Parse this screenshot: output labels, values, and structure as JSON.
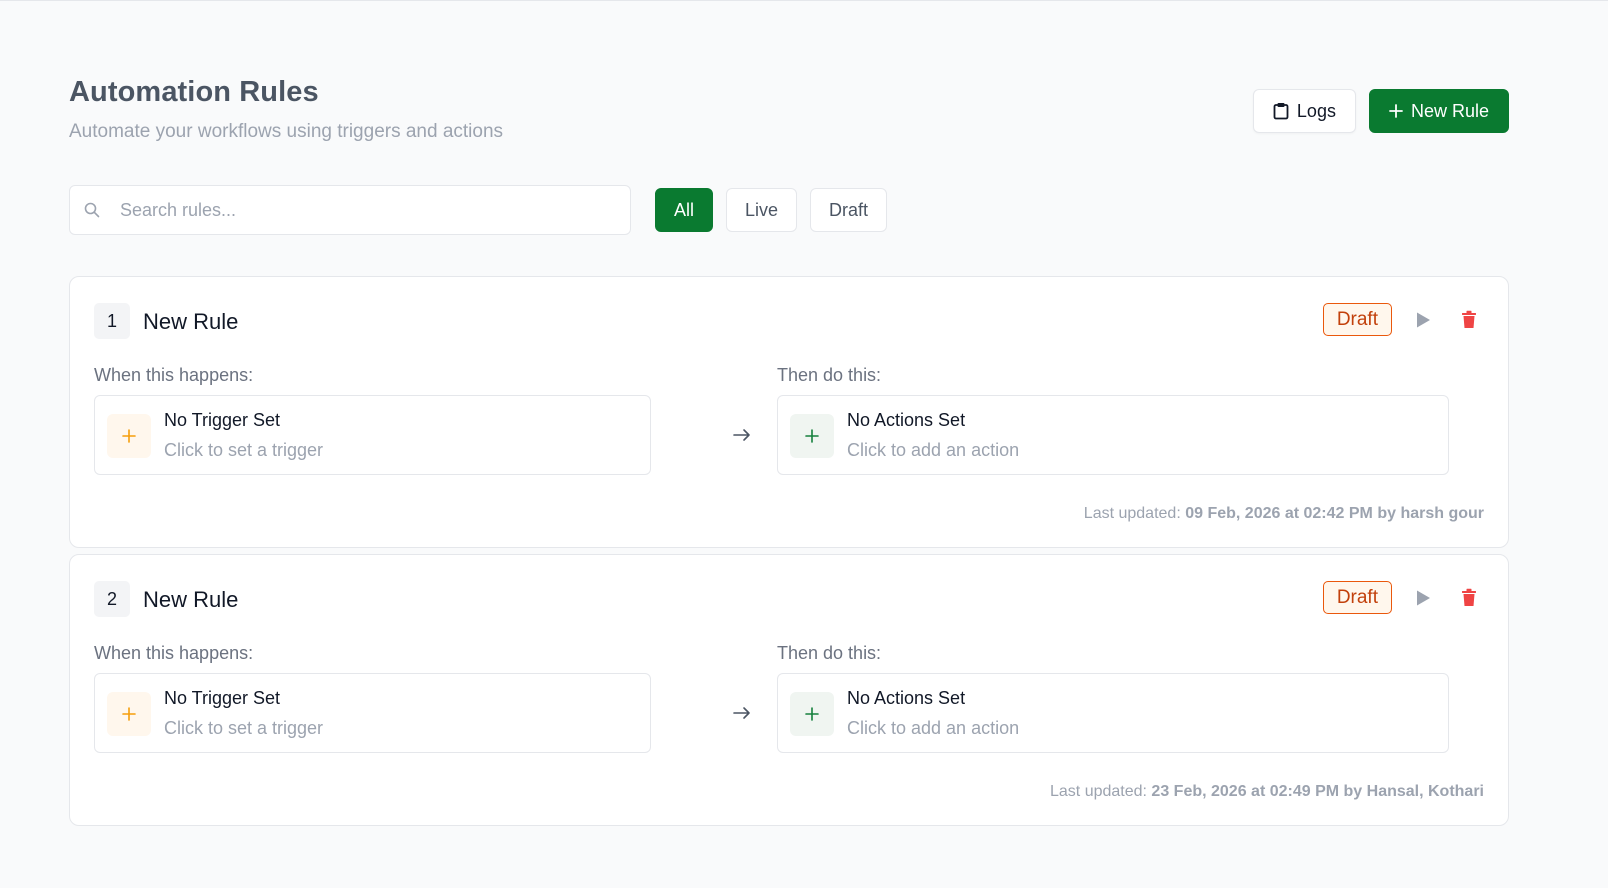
{
  "header": {
    "title": "Automation Rules",
    "subtitle": "Automate your workflows using triggers and actions",
    "logs_label": "Logs",
    "new_rule_label": "New Rule"
  },
  "search": {
    "placeholder": "Search rules...",
    "value": ""
  },
  "filters": [
    {
      "label": "All",
      "active": true
    },
    {
      "label": "Live",
      "active": false
    },
    {
      "label": "Draft",
      "active": false
    }
  ],
  "rules": [
    {
      "number": "1",
      "name": "New Rule",
      "status": "Draft",
      "when_label": "When this happens:",
      "then_label": "Then do this:",
      "trigger_title": "No Trigger Set",
      "trigger_sub": "Click to set a trigger",
      "action_title": "No Actions Set",
      "action_sub": "Click to add an action",
      "updated_label": "Last updated:",
      "updated_value": "09 Feb, 2026 at 02:42 PM by harsh gour"
    },
    {
      "number": "2",
      "name": "New Rule",
      "status": "Draft",
      "when_label": "When this happens:",
      "then_label": "Then do this:",
      "trigger_title": "No Trigger Set",
      "trigger_sub": "Click to set a trigger",
      "action_title": "No Actions Set",
      "action_sub": "Click to add an action",
      "updated_label": "Last updated:",
      "updated_value": "23 Feb, 2026 at 02:49 PM by Hansal, Kothari"
    }
  ],
  "colors": {
    "primary": "#0a7a30",
    "draft_border": "#ea580c",
    "delete": "#ef4444",
    "trigger_accent": "#f59e0b"
  },
  "icons": {
    "logs": "clipboard-icon",
    "new_rule": "plus-icon",
    "search": "search-icon",
    "run": "play-icon",
    "delete": "trash-icon",
    "flow": "arrow-right-icon"
  }
}
